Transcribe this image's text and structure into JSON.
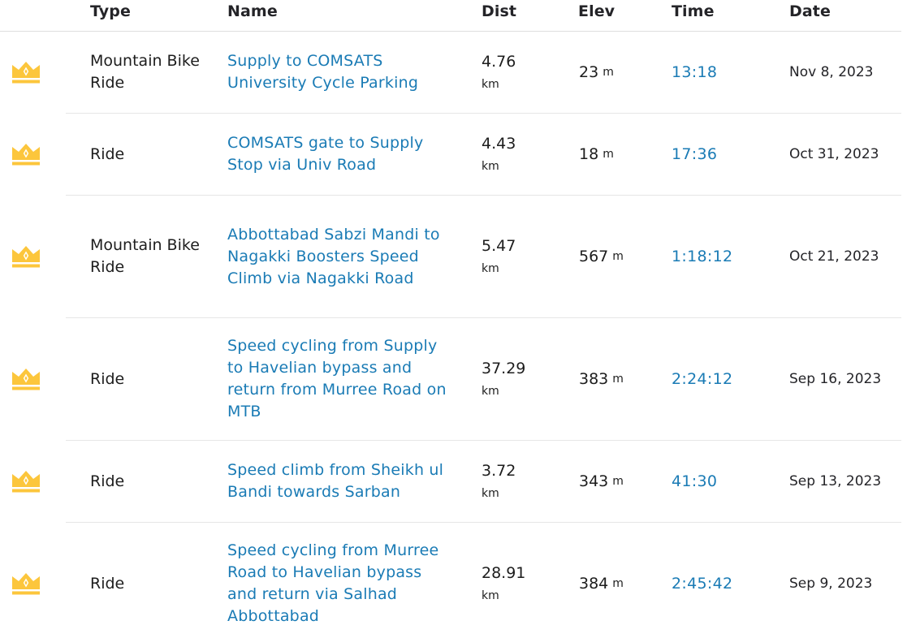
{
  "headers": {
    "type": "Type",
    "name": "Name",
    "dist": "Dist",
    "elev": "Elev",
    "time": "Time",
    "date": "Date"
  },
  "accent_color": "#1a7bb5",
  "crown_color": "#fcc63c",
  "rows": [
    {
      "icon": "crown-icon",
      "type": "Mountain Bike Ride",
      "name": "Supply to COMSATS University Cycle Parking",
      "dist": "4.76",
      "dist_unit": "km",
      "elev": "23",
      "elev_unit": "m",
      "time": "13:18",
      "date": "Nov 8, 2023"
    },
    {
      "icon": "crown-icon",
      "type": "Ride",
      "name": "COMSATS gate to Supply Stop via Univ Road",
      "dist": "4.43",
      "dist_unit": "km",
      "elev": "18",
      "elev_unit": "m",
      "time": "17:36",
      "date": "Oct 31, 2023"
    },
    {
      "icon": "crown-icon",
      "type": "Mountain Bike Ride",
      "name": "Abbottabad Sabzi Mandi to Nagakki Boosters Speed Climb via Nagakki Road",
      "dist": "5.47",
      "dist_unit": "km",
      "elev": "567",
      "elev_unit": "m",
      "time": "1:18:12",
      "date": "Oct 21, 2023"
    },
    {
      "icon": "crown-icon",
      "type": "Ride",
      "name": "Speed cycling from Supply to Havelian bypass and return from Murree Road on MTB",
      "dist": "37.29",
      "dist_unit": "km",
      "elev": "383",
      "elev_unit": "m",
      "time": "2:24:12",
      "date": "Sep 16, 2023"
    },
    {
      "icon": "crown-icon",
      "type": "Ride",
      "name": "Speed climb from Sheikh ul Bandi towards Sarban",
      "dist": "3.72",
      "dist_unit": "km",
      "elev": "343",
      "elev_unit": "m",
      "time": "41:30",
      "date": "Sep 13, 2023"
    },
    {
      "icon": "crown-icon",
      "type": "Ride",
      "name": "Speed cycling from Murree Road to Havelian bypass and return via Salhad Abbottabad",
      "dist": "28.91",
      "dist_unit": "km",
      "elev": "384",
      "elev_unit": "m",
      "time": "2:45:42",
      "date": "Sep 9, 2023"
    }
  ]
}
